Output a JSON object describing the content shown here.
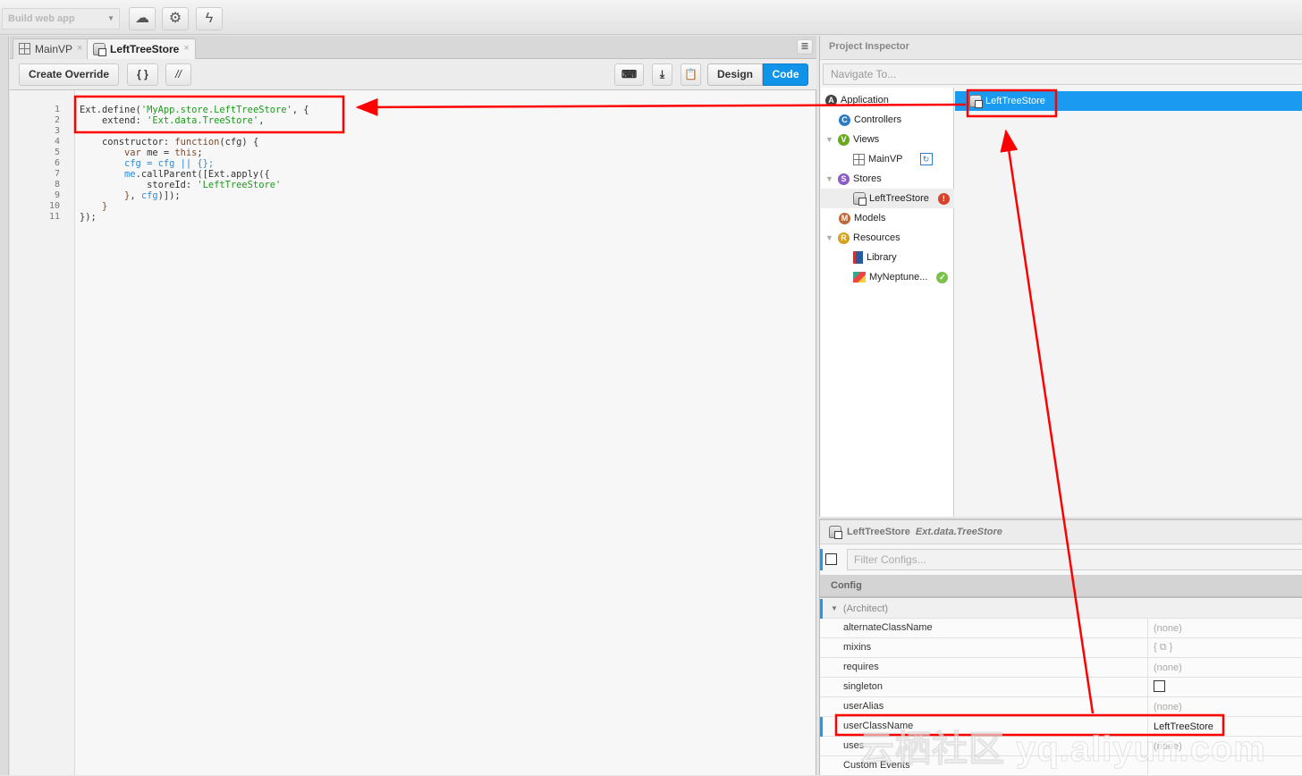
{
  "toolbar": {
    "build_select": "Build web app",
    "buttons": [
      {
        "icon": "cloud-upload-icon"
      },
      {
        "icon": "gear-icon"
      },
      {
        "icon": "lightning-icon"
      }
    ]
  },
  "editor": {
    "tabs": [
      {
        "label": "MainVP",
        "close": "×",
        "icon": "viewport-icon"
      },
      {
        "label": "LeftTreeStore",
        "close": "×",
        "icon": "store-icon",
        "active": true
      }
    ],
    "create_override": "Create Override",
    "braces": "{ }",
    "comment": "//",
    "design": "Design",
    "code": "Code",
    "active_mode": "Code",
    "line_numbers": "1\n2\n3\n4\n5\n6\n7\n8\n9\n10\n11",
    "code_lines": [
      [
        [
          "",
          "Ext.define("
        ],
        [
          "s",
          "'MyApp.store.LeftTreeStore'"
        ],
        [
          "",
          ", {"
        ]
      ],
      [
        [
          "",
          "    extend: "
        ],
        [
          "s",
          "'Ext.data.TreeStore'"
        ],
        [
          "",
          ","
        ]
      ],
      [],
      [
        [
          "",
          "    constructor: "
        ],
        [
          "k",
          "function"
        ],
        [
          "",
          "(cfg) {"
        ]
      ],
      [
        [
          "k",
          "        var"
        ],
        [
          "",
          " me = "
        ],
        [
          "k",
          "this"
        ],
        [
          "",
          ";"
        ]
      ],
      [
        [
          "v",
          "        cfg = cfg || {};"
        ]
      ],
      [
        [
          "v",
          "        me"
        ],
        [
          "",
          ".callParent([Ext.apply({"
        ]
      ],
      [
        [
          "",
          "            storeId: "
        ],
        [
          "s",
          "'LeftTreeStore'"
        ]
      ],
      [
        [
          "k",
          "        }"
        ],
        [
          "",
          ", "
        ],
        [
          "v",
          "cfg"
        ],
        [
          "",
          ")]);"
        ]
      ],
      [
        [
          "k",
          "    }"
        ]
      ],
      [
        [
          "",
          "});"
        ]
      ]
    ]
  },
  "inspector": {
    "title": "Project Inspector",
    "navigate_placeholder": "Navigate To...",
    "tree": [
      {
        "label": "Application",
        "badge": "A",
        "color": "#444"
      },
      {
        "label": "Controllers",
        "badge": "C",
        "color": "#2b7cc4"
      },
      {
        "label": "Views",
        "badge": "V",
        "color": "#6aa820",
        "expanded": true
      },
      {
        "label": "MainVP"
      },
      {
        "label": "Stores",
        "badge": "S",
        "color": "#8a5cc4",
        "expanded": true
      },
      {
        "label": "LeftTreeStore",
        "status": "error"
      },
      {
        "label": "Models",
        "badge": "M",
        "color": "#c0683a"
      },
      {
        "label": "Resources",
        "badge": "R",
        "color": "#d4a020",
        "expanded": true
      },
      {
        "label": "Library"
      },
      {
        "label": "MyNeptune...",
        "status": "ok"
      }
    ],
    "selected": "LeftTreeStore"
  },
  "config": {
    "class_name": "LeftTreeStore",
    "extends": "Ext.data.TreeStore",
    "filter_placeholder": "Filter Configs...",
    "section": "Config",
    "group": "(Architect)",
    "rows": [
      {
        "name": "alternateClassName",
        "value": "(none)"
      },
      {
        "name": "mixins",
        "value": "{ ⧉ }"
      },
      {
        "name": "requires",
        "value": "(none)"
      },
      {
        "name": "singleton",
        "value": "",
        "checkbox": true,
        "checked": false
      },
      {
        "name": "userAlias",
        "value": "(none)"
      },
      {
        "name": "userClassName",
        "value": "LeftTreeStore"
      },
      {
        "name": "uses",
        "value": "(none)"
      },
      {
        "name": "Custom Events",
        "value": ""
      }
    ]
  },
  "annotation_color": "#ff0000",
  "watermark": "云栖社区 yq.aliyun.com"
}
